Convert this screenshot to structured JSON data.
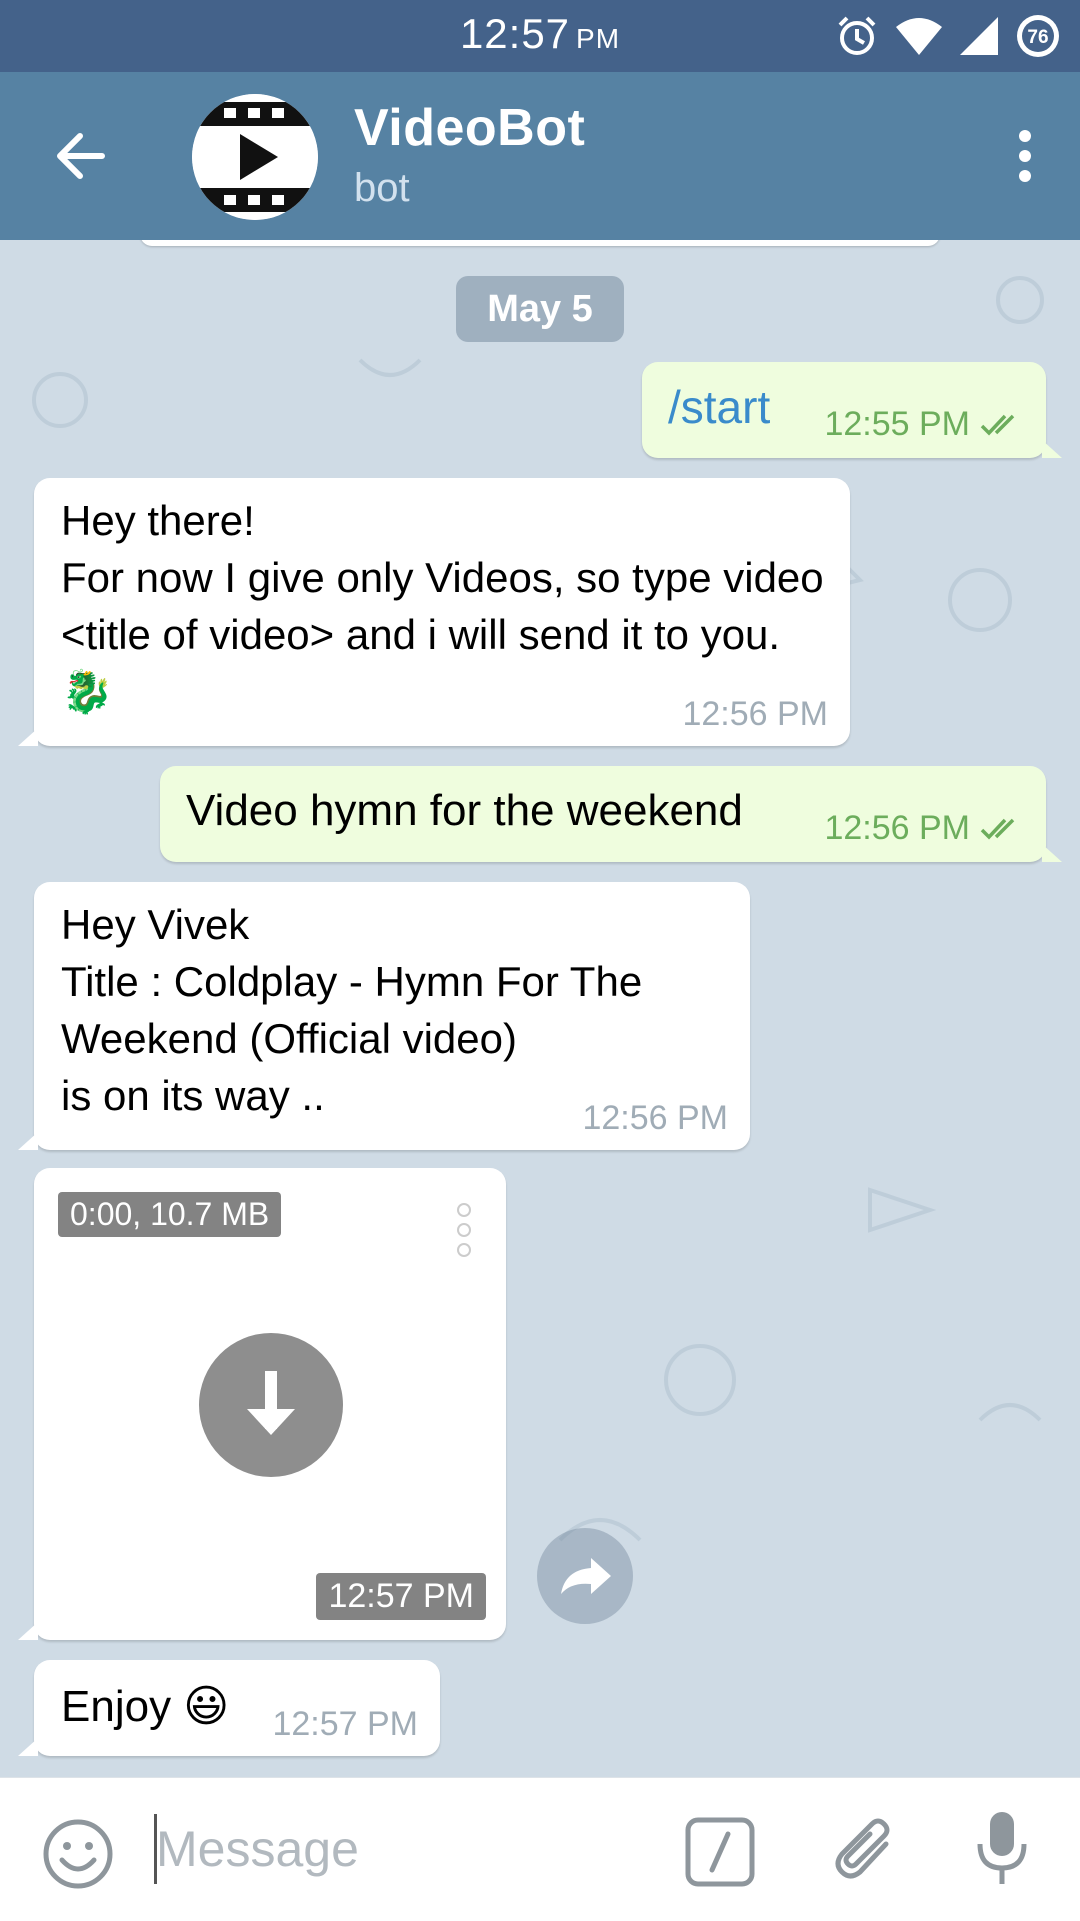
{
  "status_bar": {
    "time": "12:57",
    "ampm": "PM",
    "battery_level": "76",
    "icons": [
      "alarm-icon",
      "wifi-icon",
      "signal-icon",
      "battery-icon"
    ]
  },
  "header": {
    "title": "VideoBot",
    "subtitle": "bot",
    "icons": [
      "back-arrow-icon",
      "bot-avatar-film-play-icon",
      "more-vert-icon"
    ]
  },
  "chat": {
    "date": "May 5",
    "messages": [
      {
        "id": "m1",
        "dir": "out",
        "text": "/start",
        "time": "12:55 PM",
        "read": true
      },
      {
        "id": "m2",
        "dir": "in",
        "text": "Hey there!\nFor now I give only Videos, so type video <title of video> and i will send it to you.🐉",
        "time": "12:56 PM"
      },
      {
        "id": "m3",
        "dir": "out",
        "text": "Video hymn for the weekend",
        "time": "12:56 PM",
        "read": true
      },
      {
        "id": "m4",
        "dir": "in",
        "text": "Hey Vivek\nTitle : Coldplay - Hymn For The Weekend (Official video)\nis on its way ..",
        "time": "12:56 PM"
      },
      {
        "id": "m5",
        "dir": "in",
        "type": "video",
        "info": "0:00, 10.7 MB",
        "time": "12:57 PM"
      },
      {
        "id": "m6",
        "dir": "in",
        "text": "Enjoy 😃",
        "time": "12:57 PM"
      }
    ]
  },
  "input": {
    "placeholder": "Message",
    "icons": [
      "emoji-icon",
      "slash-command-icon",
      "attach-paperclip-icon",
      "microphone-icon"
    ]
  },
  "colors": {
    "status_bar": "#44628a",
    "app_bar": "#5682a3",
    "chat_bg": "#cfdbe5",
    "incoming_bubble": "#ffffff",
    "outgoing_bubble": "#effdde",
    "outgoing_time": "#6cad5c",
    "command_link": "#3a8bcb"
  }
}
